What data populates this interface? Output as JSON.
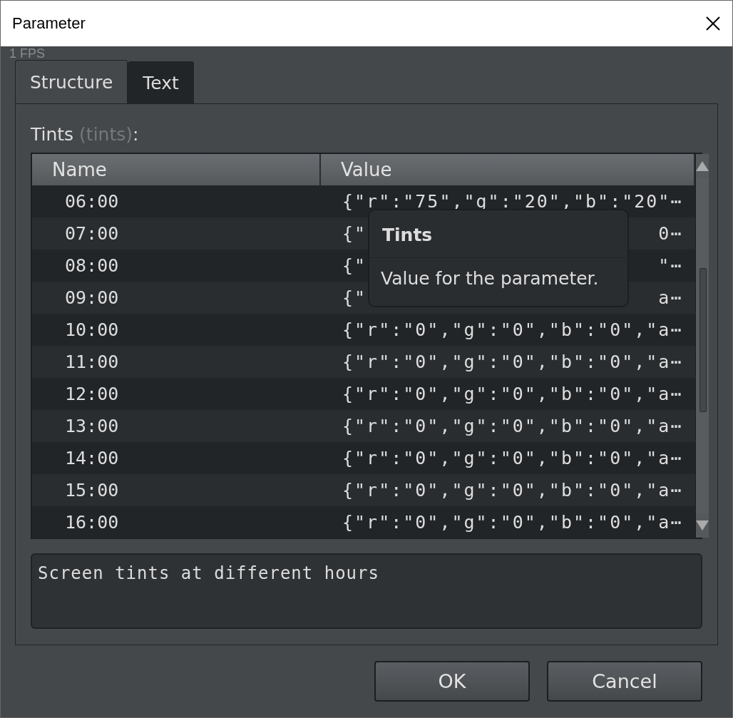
{
  "window": {
    "title": "Parameter"
  },
  "fps_overlay": "1 FPS",
  "tabs": [
    {
      "label": "Structure",
      "selected": true
    },
    {
      "label": "Text",
      "selected": false
    }
  ],
  "field_label": {
    "name": "Tints",
    "key": "(tints)",
    "suffix": ":"
  },
  "table": {
    "columns": [
      "Name",
      "Value"
    ],
    "rows": [
      {
        "name": "06:00",
        "value": "{\"r\":\"75\",\"g\":\"20\",\"b\":\"20\"⋯"
      },
      {
        "name": "07:00",
        "value_start": "{\"",
        "value_end": "0⋯"
      },
      {
        "name": "08:00",
        "value_start": "{\"",
        "value_end": "\"⋯"
      },
      {
        "name": "09:00",
        "value_start": "{\"",
        "value_end": "a⋯"
      },
      {
        "name": "10:00",
        "value": "{\"r\":\"0\",\"g\":\"0\",\"b\":\"0\",\"a⋯"
      },
      {
        "name": "11:00",
        "value": "{\"r\":\"0\",\"g\":\"0\",\"b\":\"0\",\"a⋯"
      },
      {
        "name": "12:00",
        "value": "{\"r\":\"0\",\"g\":\"0\",\"b\":\"0\",\"a⋯"
      },
      {
        "name": "13:00",
        "value": "{\"r\":\"0\",\"g\":\"0\",\"b\":\"0\",\"a⋯"
      },
      {
        "name": "14:00",
        "value": "{\"r\":\"0\",\"g\":\"0\",\"b\":\"0\",\"a⋯"
      },
      {
        "name": "15:00",
        "value": "{\"r\":\"0\",\"g\":\"0\",\"b\":\"0\",\"a⋯"
      },
      {
        "name": "16:00",
        "value": "{\"r\":\"0\",\"g\":\"0\",\"b\":\"0\",\"a⋯"
      }
    ]
  },
  "tooltip": {
    "title": "Tints",
    "text": "Value for the parameter."
  },
  "description": "Screen tints at different hours",
  "buttons": [
    "OK",
    "Cancel"
  ]
}
